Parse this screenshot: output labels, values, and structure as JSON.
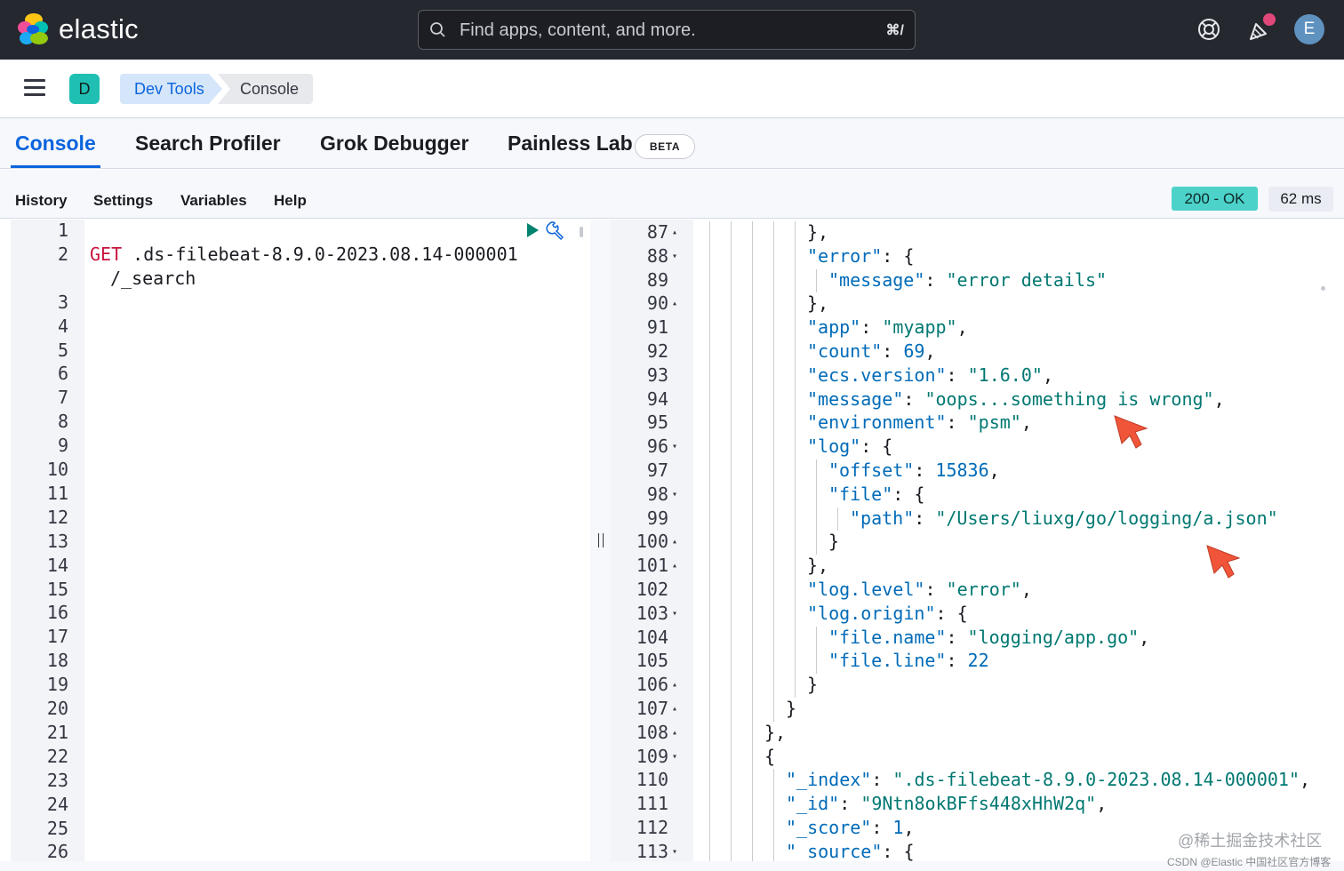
{
  "header": {
    "brand": "elastic",
    "search_placeholder": "Find apps, content, and more.",
    "search_shortcut": "⌘/",
    "avatar_initial": "E",
    "colors": {
      "bar": "#25282f",
      "avatar": "#6092c0",
      "notification": "#e0487a"
    }
  },
  "breadcrumbs": {
    "space_initial": "D",
    "items": [
      "Dev Tools",
      "Console"
    ]
  },
  "tabs": [
    {
      "label": "Console",
      "active": true
    },
    {
      "label": "Search Profiler",
      "active": false
    },
    {
      "label": "Grok Debugger",
      "active": false
    },
    {
      "label": "Painless Lab",
      "active": false,
      "badge": "BETA"
    }
  ],
  "toolbar": {
    "items": [
      "History",
      "Settings",
      "Variables",
      "Help"
    ],
    "status": "200 - OK",
    "duration": "62 ms"
  },
  "request_editor": {
    "line_numbers": [
      "1",
      "2",
      "3",
      "4",
      "5",
      "6",
      "7",
      "8",
      "9",
      "10",
      "11",
      "12",
      "13",
      "14",
      "15",
      "16",
      "17",
      "18",
      "19",
      "20",
      "21",
      "22",
      "23",
      "24",
      "25",
      "26"
    ],
    "method": "GET",
    "path_line1": ".ds-filebeat-8.9.0-2023.08.14-000001",
    "path_line2": "/_search",
    "icons": [
      "play-icon",
      "wrench-icon"
    ]
  },
  "response_editor": {
    "lines": [
      {
        "n": "87",
        "fold": "up",
        "indent": 5,
        "parts": [
          [
            "p",
            "},"
          ]
        ]
      },
      {
        "n": "88",
        "fold": "down",
        "indent": 5,
        "parts": [
          [
            "k",
            "\"error\""
          ],
          [
            "p",
            ": {"
          ]
        ]
      },
      {
        "n": "89",
        "fold": "",
        "indent": 6,
        "parts": [
          [
            "k",
            "\"message\""
          ],
          [
            "p",
            ": "
          ],
          [
            "s",
            "\"error details\""
          ]
        ]
      },
      {
        "n": "90",
        "fold": "up",
        "indent": 5,
        "parts": [
          [
            "p",
            "},"
          ]
        ]
      },
      {
        "n": "91",
        "fold": "",
        "indent": 5,
        "parts": [
          [
            "k",
            "\"app\""
          ],
          [
            "p",
            ": "
          ],
          [
            "s",
            "\"myapp\""
          ],
          [
            "p",
            ","
          ]
        ]
      },
      {
        "n": "92",
        "fold": "",
        "indent": 5,
        "parts": [
          [
            "k",
            "\"count\""
          ],
          [
            "p",
            ": "
          ],
          [
            "n",
            "69"
          ],
          [
            "p",
            ","
          ]
        ]
      },
      {
        "n": "93",
        "fold": "",
        "indent": 5,
        "parts": [
          [
            "k",
            "\"ecs.version\""
          ],
          [
            "p",
            ": "
          ],
          [
            "s",
            "\"1.6.0\""
          ],
          [
            "p",
            ","
          ]
        ]
      },
      {
        "n": "94",
        "fold": "",
        "indent": 5,
        "parts": [
          [
            "k",
            "\"message\""
          ],
          [
            "p",
            ": "
          ],
          [
            "s",
            "\"oops...something is wrong\""
          ],
          [
            "p",
            ","
          ]
        ]
      },
      {
        "n": "95",
        "fold": "",
        "indent": 5,
        "parts": [
          [
            "k",
            "\"environment\""
          ],
          [
            "p",
            ": "
          ],
          [
            "s",
            "\"psm\""
          ],
          [
            "p",
            ","
          ]
        ]
      },
      {
        "n": "96",
        "fold": "down",
        "indent": 5,
        "parts": [
          [
            "k",
            "\"log\""
          ],
          [
            "p",
            ": {"
          ]
        ]
      },
      {
        "n": "97",
        "fold": "",
        "indent": 6,
        "parts": [
          [
            "k",
            "\"offset\""
          ],
          [
            "p",
            ": "
          ],
          [
            "n",
            "15836"
          ],
          [
            "p",
            ","
          ]
        ]
      },
      {
        "n": "98",
        "fold": "down",
        "indent": 6,
        "parts": [
          [
            "k",
            "\"file\""
          ],
          [
            "p",
            ": {"
          ]
        ]
      },
      {
        "n": "99",
        "fold": "",
        "indent": 7,
        "parts": [
          [
            "k",
            "\"path\""
          ],
          [
            "p",
            ": "
          ],
          [
            "s",
            "\"/Users/liuxg/go/logging/a.json\""
          ]
        ]
      },
      {
        "n": "100",
        "fold": "up",
        "indent": 6,
        "parts": [
          [
            "p",
            "}"
          ]
        ]
      },
      {
        "n": "101",
        "fold": "up",
        "indent": 5,
        "parts": [
          [
            "p",
            "},"
          ]
        ]
      },
      {
        "n": "102",
        "fold": "",
        "indent": 5,
        "parts": [
          [
            "k",
            "\"log.level\""
          ],
          [
            "p",
            ": "
          ],
          [
            "s",
            "\"error\""
          ],
          [
            "p",
            ","
          ]
        ]
      },
      {
        "n": "103",
        "fold": "down",
        "indent": 5,
        "parts": [
          [
            "k",
            "\"log.origin\""
          ],
          [
            "p",
            ": {"
          ]
        ]
      },
      {
        "n": "104",
        "fold": "",
        "indent": 6,
        "parts": [
          [
            "k",
            "\"file.name\""
          ],
          [
            "p",
            ": "
          ],
          [
            "s",
            "\"logging/app.go\""
          ],
          [
            "p",
            ","
          ]
        ]
      },
      {
        "n": "105",
        "fold": "",
        "indent": 6,
        "parts": [
          [
            "k",
            "\"file.line\""
          ],
          [
            "p",
            ": "
          ],
          [
            "n",
            "22"
          ]
        ]
      },
      {
        "n": "106",
        "fold": "up",
        "indent": 5,
        "parts": [
          [
            "p",
            "}"
          ]
        ]
      },
      {
        "n": "107",
        "fold": "up",
        "indent": 4,
        "parts": [
          [
            "p",
            "}"
          ]
        ]
      },
      {
        "n": "108",
        "fold": "up",
        "indent": 3,
        "parts": [
          [
            "p",
            "},"
          ]
        ]
      },
      {
        "n": "109",
        "fold": "down",
        "indent": 3,
        "parts": [
          [
            "p",
            "{"
          ]
        ]
      },
      {
        "n": "110",
        "fold": "",
        "indent": 4,
        "parts": [
          [
            "k",
            "\"_index\""
          ],
          [
            "p",
            ": "
          ],
          [
            "s",
            "\".ds-filebeat-8.9.0-2023.08.14-000001\""
          ],
          [
            "p",
            ","
          ]
        ]
      },
      {
        "n": "111",
        "fold": "",
        "indent": 4,
        "parts": [
          [
            "k",
            "\"_id\""
          ],
          [
            "p",
            ": "
          ],
          [
            "s",
            "\"9Ntn8okBFfs448xHhW2q\""
          ],
          [
            "p",
            ","
          ]
        ]
      },
      {
        "n": "112",
        "fold": "",
        "indent": 4,
        "parts": [
          [
            "k",
            "\"_score\""
          ],
          [
            "p",
            ": "
          ],
          [
            "n",
            "1"
          ],
          [
            "p",
            ","
          ]
        ]
      },
      {
        "n": "113",
        "fold": "down",
        "indent": 4,
        "parts": [
          [
            "k",
            "\"_source\""
          ],
          [
            "p",
            ": {"
          ]
        ]
      }
    ]
  },
  "watermark": "@稀土掘金技术社区",
  "watermark_small": "CSDN @Elastic 中国社区官方博客"
}
